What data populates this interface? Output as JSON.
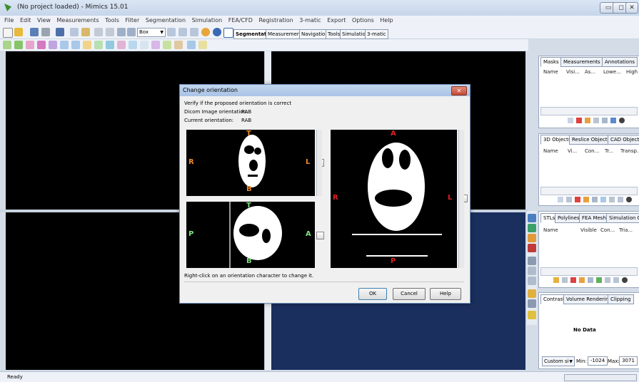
{
  "window": {
    "title": "(No project loaded) - Mimics 15.01",
    "min": "▭",
    "max": "◻",
    "close": "✕"
  },
  "menu": [
    "File",
    "Edit",
    "View",
    "Measurements",
    "Tools",
    "Filter",
    "Segmentation",
    "Simulation",
    "FEA/CFD",
    "Registration",
    "3-matic",
    "Export",
    "Options",
    "Help"
  ],
  "toolbar": {
    "box_select": "Box",
    "tabs": [
      "Segmentation",
      "Measurements",
      "Navigation",
      "Tools",
      "Simulation",
      "3-matic"
    ]
  },
  "masks_panel": {
    "tabs": [
      "Masks",
      "Measurements",
      "Annotations"
    ],
    "columns": [
      "Name",
      "Visi...",
      "As...",
      "Lowe...",
      "High"
    ]
  },
  "objects_panel": {
    "tabs": [
      "3D Objects",
      "Reslice Objects",
      "CAD Objects"
    ],
    "columns": [
      "Name",
      "Vi...",
      "Con...",
      "Tr...",
      "Transp."
    ]
  },
  "stl_panel": {
    "tabs": [
      "STLs",
      "Polylines",
      "FEA Mesh",
      "Simulation O..."
    ],
    "columns": [
      "Name",
      "Visible",
      "Con...",
      "Tria..."
    ]
  },
  "contrast_panel": {
    "tabs": [
      "Contrast",
      "Volume Rendering",
      "Clipping"
    ],
    "no_data": "No Data",
    "preset": "Custom si",
    "min_label": "Min:",
    "min_value": "-1024",
    "max_label": "Max:",
    "max_value": "3071"
  },
  "dialog": {
    "title": "Change orientation",
    "verify": "Verify if the proposed orientation is correct",
    "dicom_label": "Dicom Image orientation:",
    "dicom_value": "RAB",
    "current_label": "Current orientation:",
    "current_value": "RAB",
    "view1": {
      "top": "T",
      "bottom": "B",
      "left": "R",
      "right": "L"
    },
    "view2": {
      "top": "T",
      "bottom": "B",
      "left": "P",
      "right": "A"
    },
    "view3": {
      "top": "A",
      "bottom": "P",
      "left": "R",
      "right": "L"
    },
    "hint": "Right-click on an orientation character to change it.",
    "ok": "OK",
    "cancel": "Cancel",
    "help": "Help"
  },
  "status": "Ready"
}
